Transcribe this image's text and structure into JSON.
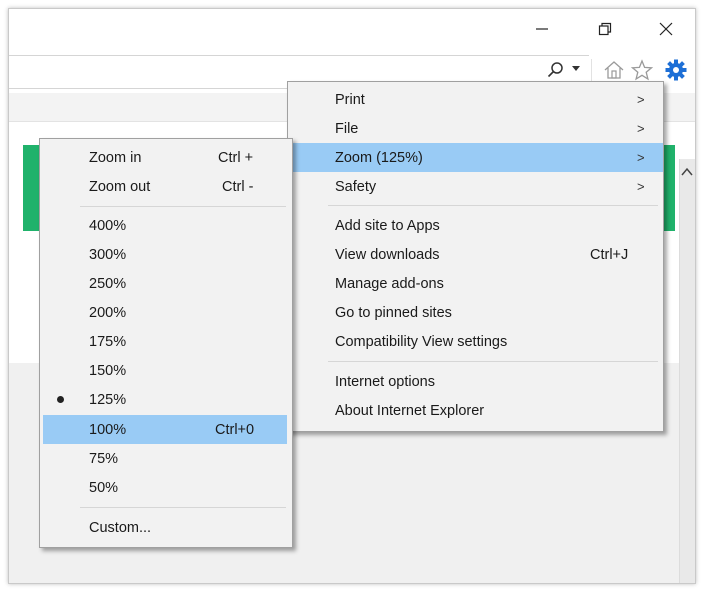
{
  "window": {
    "minimize": "minimize",
    "restore": "restore",
    "close": "close"
  },
  "toolbar": {
    "icons": [
      "search-icon",
      "home-icon",
      "favorites-star-icon",
      "tools-gear-icon"
    ]
  },
  "colors": {
    "accent_green": "#20b26b",
    "menu_bg": "#f2f2f2",
    "highlight": "#99cbf5",
    "gear": "#1d6fd6"
  },
  "main_menu": {
    "items": [
      {
        "label": "Print",
        "submenu": true
      },
      {
        "label": "File",
        "submenu": true
      },
      {
        "label": "Zoom (125%)",
        "submenu": true,
        "highlighted": true
      },
      {
        "label": "Safety",
        "submenu": true
      },
      {
        "label": "Add site to Apps"
      },
      {
        "label": "View downloads",
        "shortcut": "Ctrl+J"
      },
      {
        "label": "Manage add-ons"
      },
      {
        "label": "Go to pinned sites"
      },
      {
        "label": "Compatibility View settings"
      },
      {
        "label": "Internet options"
      },
      {
        "label": "About Internet Explorer"
      }
    ],
    "arrow": ">"
  },
  "zoom_menu": {
    "zoom_in": {
      "label": "Zoom in",
      "shortcut": "Ctrl +"
    },
    "zoom_out": {
      "label": "Zoom out",
      "shortcut": "Ctrl -"
    },
    "levels": [
      {
        "label": "400%"
      },
      {
        "label": "300%"
      },
      {
        "label": "250%"
      },
      {
        "label": "200%"
      },
      {
        "label": "175%"
      },
      {
        "label": "150%"
      },
      {
        "label": "125%",
        "selected": true
      },
      {
        "label": "100%",
        "shortcut": "Ctrl+0",
        "highlighted": true
      },
      {
        "label": "75%"
      },
      {
        "label": "50%"
      }
    ],
    "custom": {
      "label": "Custom..."
    }
  }
}
